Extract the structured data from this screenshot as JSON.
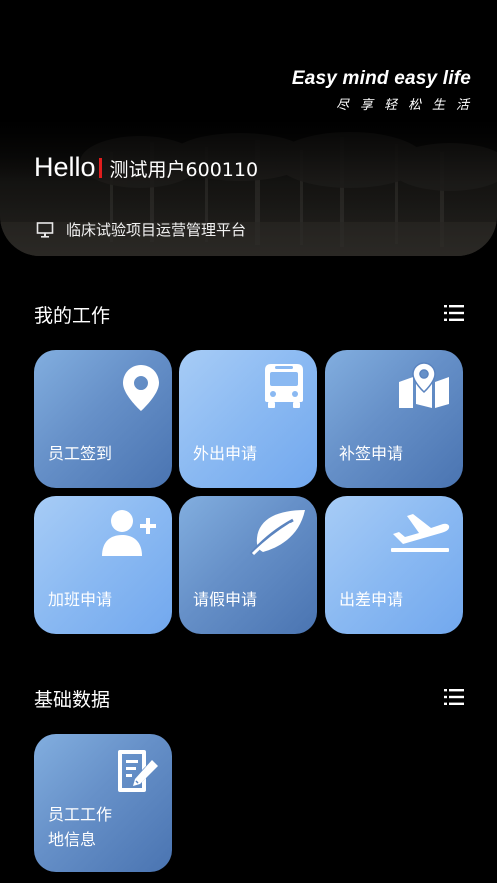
{
  "header": {
    "slogan_en": "Easy mind easy life",
    "slogan_cn": "尽享轻松生活"
  },
  "greeting": {
    "hello": "Hello",
    "username": "测试用户600110",
    "platform_icon": "monitor-icon",
    "platform_name": "临床试验项目运营管理平台"
  },
  "my_work": {
    "title": "我的工作",
    "menu_icon": "list-icon",
    "tiles": [
      {
        "label": "员工签到",
        "icon": "map-pin-icon",
        "style": "dark"
      },
      {
        "label": "外出申请",
        "icon": "bus-icon",
        "style": "light"
      },
      {
        "label": "补签申请",
        "icon": "map-location-icon",
        "style": "dark"
      },
      {
        "label": "加班申请",
        "icon": "add-user-icon",
        "style": "light"
      },
      {
        "label": "请假申请",
        "icon": "leaf-icon",
        "style": "dark"
      },
      {
        "label": "出差申请",
        "icon": "plane-departure-icon",
        "style": "light"
      }
    ]
  },
  "basic_data": {
    "title": "基础数据",
    "menu_icon": "list-icon",
    "tiles": [
      {
        "label_line1": "员工工作",
        "label_line2": "地信息",
        "icon": "edit-document-icon",
        "style": "dark"
      }
    ]
  },
  "colors": {
    "background": "#000000",
    "tile_dark": "#5b84bf",
    "tile_light": "#8ab9f2",
    "hello_accent": "#e11d1d"
  }
}
